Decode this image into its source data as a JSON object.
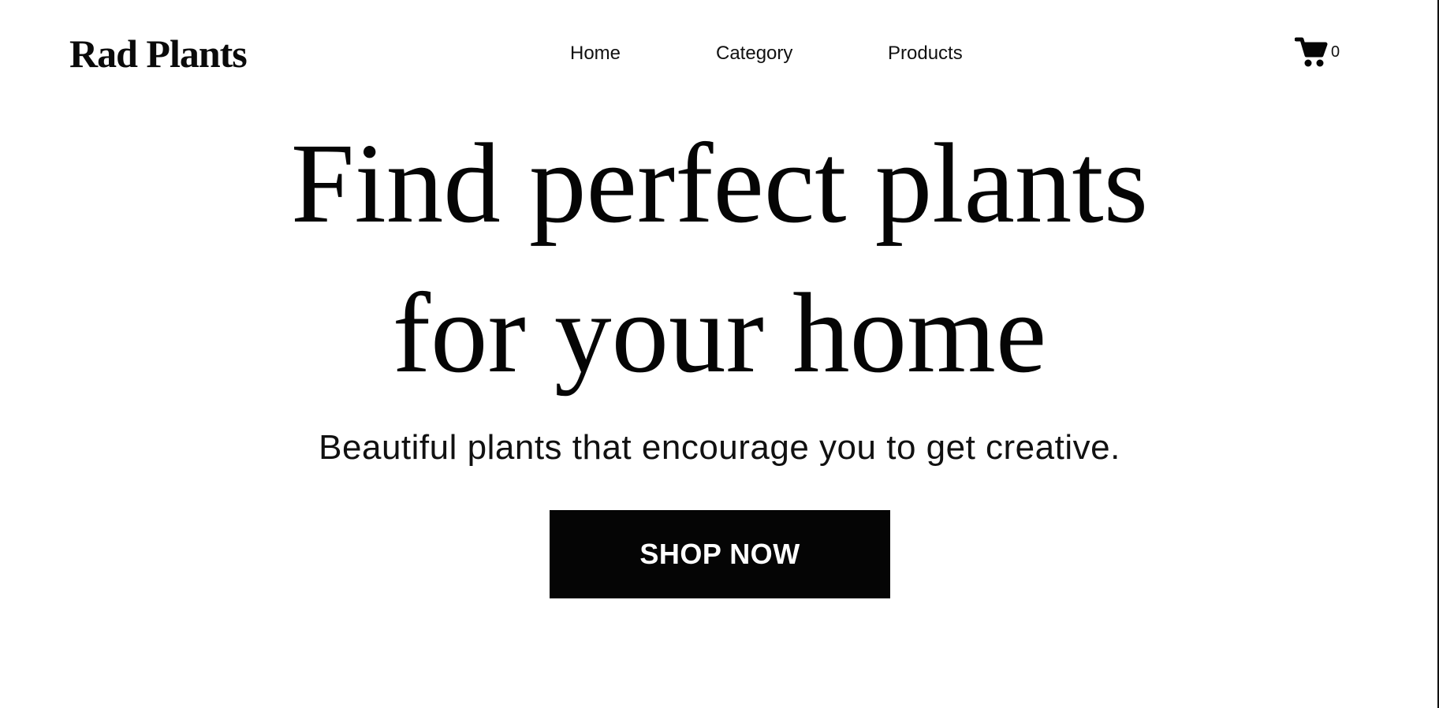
{
  "header": {
    "brand": "Rad Plants",
    "nav": {
      "home": "Home",
      "category": "Category",
      "products": "Products"
    },
    "cart": {
      "icon": "shopping-cart-icon",
      "count": "0"
    }
  },
  "hero": {
    "title_line_1": "Find perfect plants",
    "title_line_2": "for your home",
    "subtitle": "Beautiful plants that encourage you to get creative.",
    "cta_label": "SHOP NOW"
  },
  "colors": {
    "background": "#ffffff",
    "text": "#0a0a0a",
    "button_background": "#050505",
    "button_text": "#ffffff"
  }
}
